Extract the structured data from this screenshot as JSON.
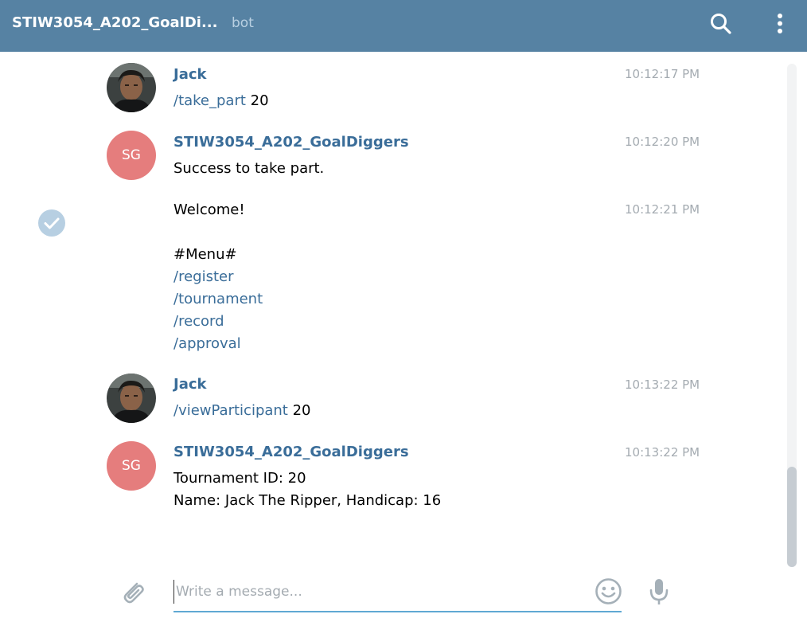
{
  "header": {
    "title": "STIW3054_A202_GoalDi...",
    "subtitle": "bot"
  },
  "messages": [
    {
      "author": "Jack",
      "time": "10:12:17 PM",
      "command": "/take_part",
      "arg": " 20"
    },
    {
      "author": "STIW3054_A202_GoalDiggers",
      "avatar_initials": "SG",
      "time": "10:12:20 PM",
      "text": "Success to take part."
    },
    {
      "time": "10:12:21 PM",
      "welcome": "Welcome!",
      "menu_heading": "#Menu#",
      "menu_items": [
        "/register",
        "/tournament",
        "/record",
        "/approval"
      ]
    },
    {
      "author": "Jack",
      "time": "10:13:22 PM",
      "command": "/viewParticipant",
      "arg": " 20"
    },
    {
      "author": "STIW3054_A202_GoalDiggers",
      "avatar_initials": "SG",
      "time": "10:13:22 PM",
      "line1": "Tournament ID: 20",
      "line2": "Name: Jack The Ripper,  Handicap: 16"
    }
  ],
  "composer": {
    "placeholder": "Write a message..."
  },
  "colors": {
    "header_bg": "#5682a3",
    "accent_text": "#3a6d99",
    "bot_avatar": "#e57d7d",
    "timestamp": "#a4abb1",
    "input_focus": "#5fa8d3"
  },
  "icons": {
    "search": "search-icon",
    "menu": "more-vertical-icon",
    "check": "check-circle-icon",
    "attach": "paperclip-icon",
    "emoji": "smiley-icon",
    "mic": "microphone-icon"
  }
}
